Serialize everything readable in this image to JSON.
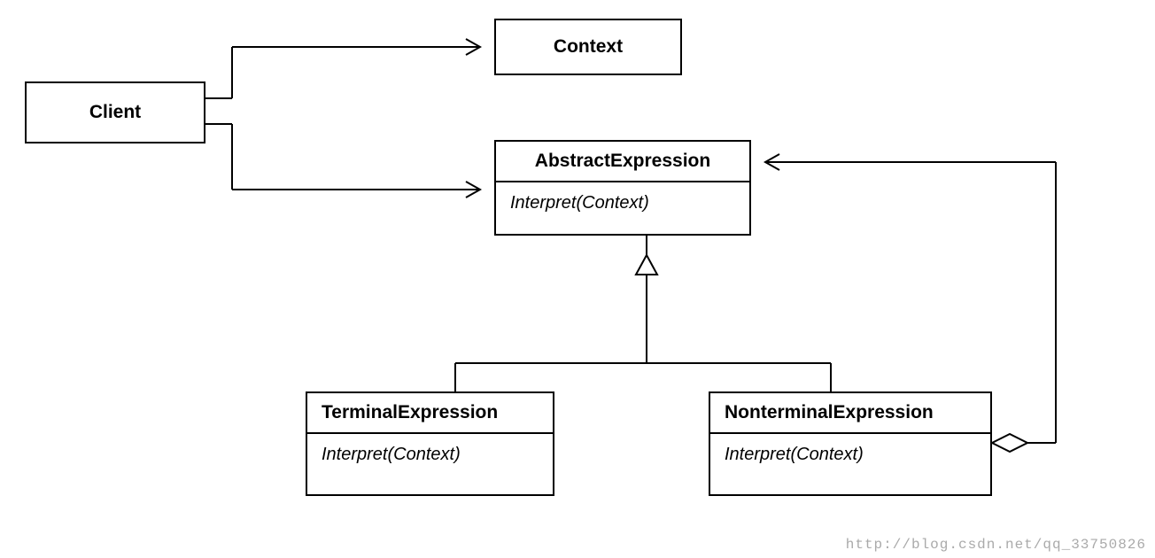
{
  "client": {
    "label": "Client"
  },
  "context": {
    "label": "Context"
  },
  "abstractExpression": {
    "title": "AbstractExpression",
    "method": "Interpret(Context)"
  },
  "terminalExpression": {
    "title": "TerminalExpression",
    "method": "Interpret(Context)"
  },
  "nonterminalExpression": {
    "title": "NonterminalExpression",
    "method": "Interpret(Context)"
  },
  "watermark": "http://blog.csdn.net/qq_33750826"
}
